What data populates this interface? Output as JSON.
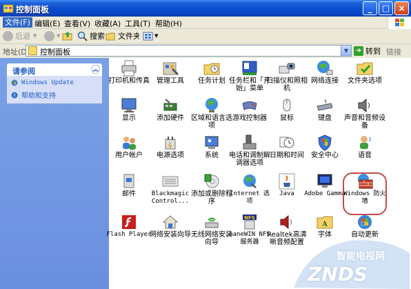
{
  "window": {
    "title": "控制面板",
    "icon": "control-panel-icon",
    "buttons": [
      "minimize",
      "maximize",
      "close"
    ]
  },
  "menu": {
    "items": [
      "文件(F)",
      "编辑(E)",
      "查看(V)",
      "收藏(A)",
      "工具(T)",
      "帮助(H)"
    ],
    "active": "文件(F)"
  },
  "toolbar": {
    "back": "后退",
    "search": "搜索",
    "folders": "文件夹"
  },
  "address": {
    "label": "地址(D)",
    "value": "控制面板",
    "go": "转到",
    "links": "链接"
  },
  "sidebar": {
    "title": "请参阅",
    "links": [
      {
        "label": "Windows Update",
        "icon": "windows-update-icon"
      },
      {
        "label": "帮助和支持",
        "icon": "help-icon"
      }
    ]
  },
  "items": [
    {
      "label": "打印机和传真",
      "icon": "printer-icon"
    },
    {
      "label": "管理工具",
      "icon": "admin-tools-icon"
    },
    {
      "label": "任务计划",
      "icon": "scheduled-tasks-icon"
    },
    {
      "label": "任务栏和「开始」菜单",
      "icon": "taskbar-icon"
    },
    {
      "label": "扫描仪和照相机",
      "icon": "scanner-icon"
    },
    {
      "label": "网络连接",
      "icon": "network-icon"
    },
    {
      "label": "文件夹选项",
      "icon": "folder-options-icon"
    },
    {
      "label": "显示",
      "icon": "display-icon"
    },
    {
      "label": "添加硬件",
      "icon": "add-hardware-icon"
    },
    {
      "label": "区域和语言选项",
      "icon": "region-icon"
    },
    {
      "label": "游戏控制器",
      "icon": "game-controller-icon"
    },
    {
      "label": "鼠标",
      "icon": "mouse-icon"
    },
    {
      "label": "键盘",
      "icon": "keyboard-icon"
    },
    {
      "label": "声音和音频设备",
      "icon": "sound-icon"
    },
    {
      "label": "用户帐户",
      "icon": "user-accounts-icon"
    },
    {
      "label": "电源选项",
      "icon": "power-icon"
    },
    {
      "label": "系统",
      "icon": "system-icon"
    },
    {
      "label": "电话和调制解调器选项",
      "icon": "phone-modem-icon"
    },
    {
      "label": "日期和时间",
      "icon": "date-time-icon"
    },
    {
      "label": "安全中心",
      "icon": "security-center-icon"
    },
    {
      "label": "语音",
      "icon": "speech-icon"
    },
    {
      "label": "邮件",
      "icon": "mail-icon"
    },
    {
      "label": "Blackmagic Control...",
      "icon": "blackmagic-icon"
    },
    {
      "label": "添加或删除程序",
      "icon": "add-remove-icon"
    },
    {
      "label": "Internet 选项",
      "icon": "internet-options-icon"
    },
    {
      "label": "Java",
      "icon": "java-icon"
    },
    {
      "label": "Adobe Gamma",
      "icon": "adobe-gamma-icon"
    },
    {
      "label": "Windows 防火墙",
      "icon": "firewall-icon"
    },
    {
      "label": "Flash Player",
      "icon": "flash-icon"
    },
    {
      "label": "网络安装向导",
      "icon": "network-setup-icon"
    },
    {
      "label": "无线网络安装向导",
      "icon": "wireless-icon"
    },
    {
      "label": "haneWIN NFS 服务器",
      "icon": "nfs-icon"
    },
    {
      "label": "Realtek高清晰音频配置",
      "icon": "realtek-icon"
    },
    {
      "label": "字体",
      "icon": "fonts-icon"
    },
    {
      "label": "自动更新",
      "icon": "auto-update-icon"
    }
  ],
  "watermark": {
    "main": "ZNDS",
    "sub": "智能电视网"
  }
}
